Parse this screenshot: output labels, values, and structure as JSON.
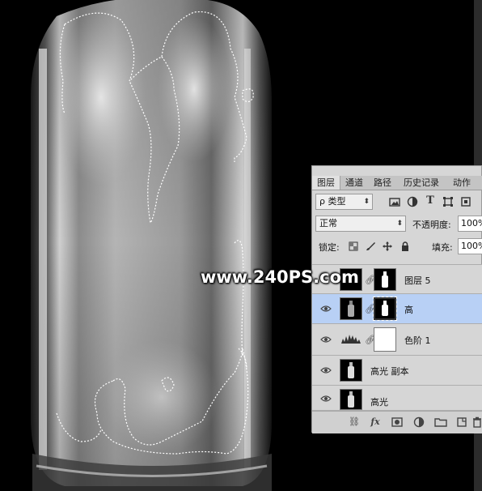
{
  "watermark": "www.240PS.com",
  "tabs": [
    {
      "label": "图层",
      "active": true
    },
    {
      "label": "通道",
      "active": false
    },
    {
      "label": "路径",
      "active": false
    },
    {
      "label": "历史记录",
      "active": false
    },
    {
      "label": "动作",
      "active": false
    }
  ],
  "filter": {
    "label": "ρ 类型",
    "icons": [
      "image-filter-icon",
      "adjustment-filter-icon",
      "type-filter-icon",
      "shape-filter-icon",
      "smart-object-filter-icon"
    ]
  },
  "blend": {
    "mode": "正常",
    "opacity_label": "不透明度:",
    "opacity_value": "100%"
  },
  "lock": {
    "label": "锁定:",
    "fill_label": "填充:",
    "fill_value": "100%"
  },
  "layers": [
    {
      "name": "图层 5",
      "visible": false,
      "selected": false,
      "kind": "mask"
    },
    {
      "name": "高",
      "visible": true,
      "selected": true,
      "kind": "mask"
    },
    {
      "name": "色阶 1",
      "visible": true,
      "selected": false,
      "kind": "levels"
    },
    {
      "name": "高光 副本",
      "visible": true,
      "selected": false,
      "kind": "image"
    },
    {
      "name": "高光",
      "visible": true,
      "selected": false,
      "kind": "image"
    }
  ],
  "footer_icons": [
    "link-layers-icon",
    "fx-icon",
    "add-mask-icon",
    "adjustment-layer-icon",
    "new-group-icon",
    "new-layer-icon",
    "trash-icon"
  ],
  "footer_fx": "fx"
}
